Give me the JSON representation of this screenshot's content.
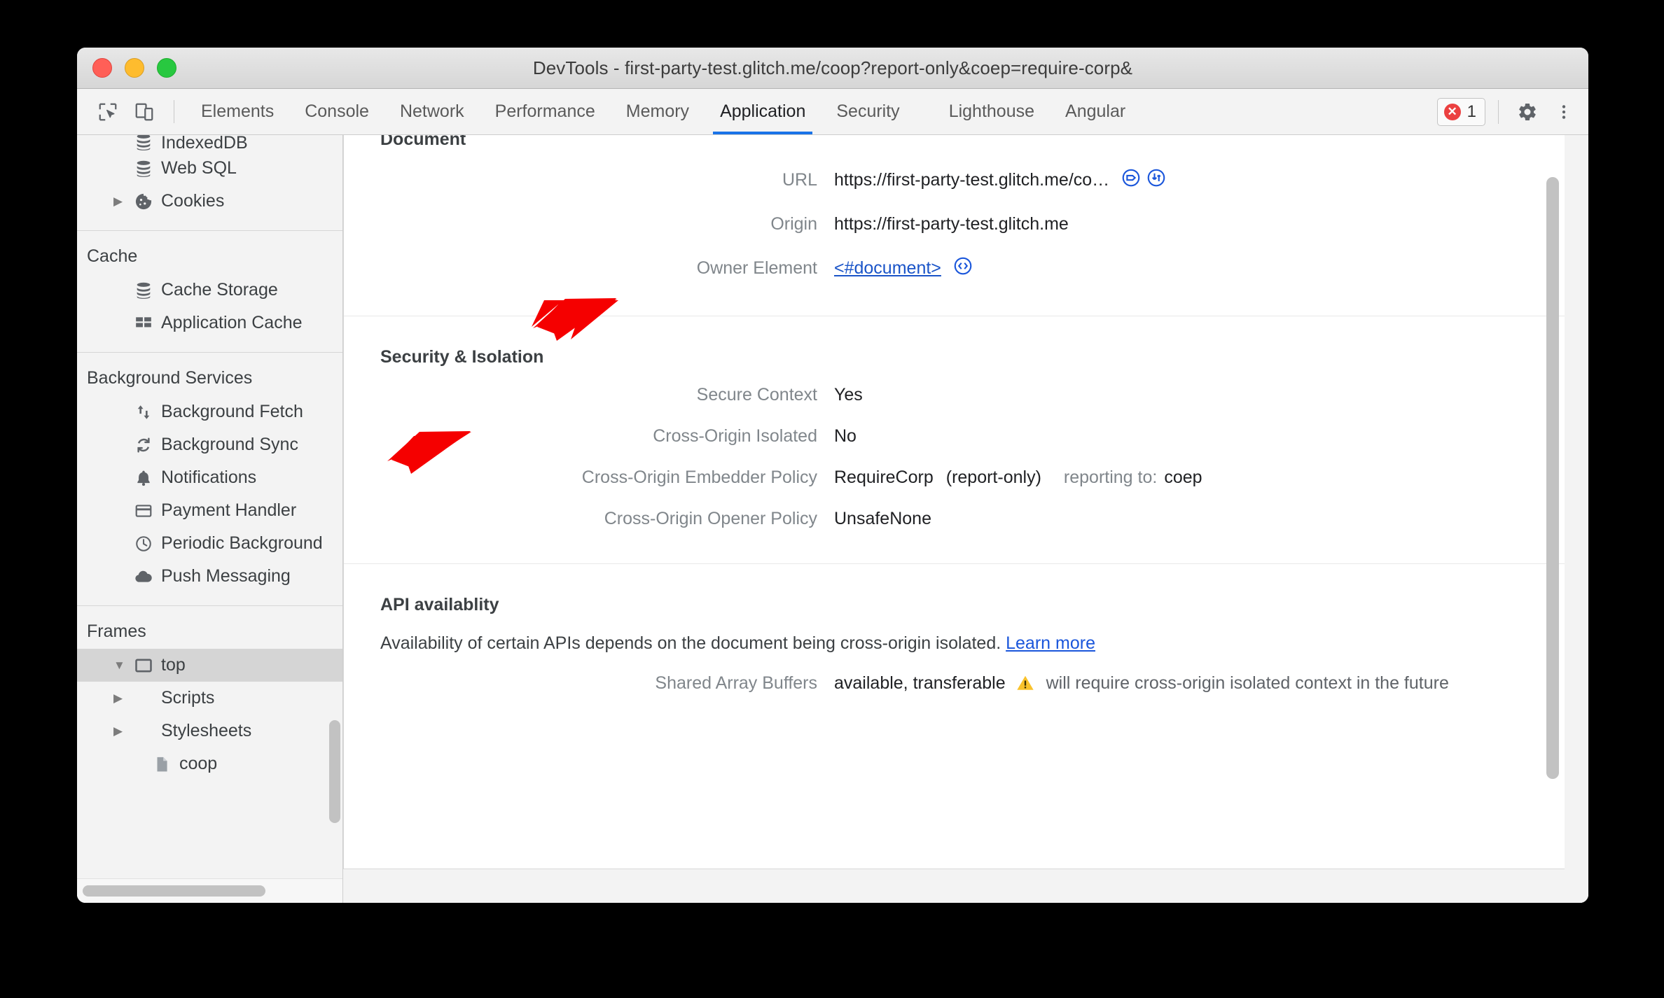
{
  "window": {
    "title": "DevTools - first-party-test.glitch.me/coop?report-only&coep=require-corp&"
  },
  "toolbar": {
    "inspect_icon": "inspect-element-icon",
    "device_icon": "device-toolbar-icon",
    "tabs": [
      {
        "label": "Elements",
        "selected": false
      },
      {
        "label": "Console",
        "selected": false
      },
      {
        "label": "Network",
        "selected": false
      },
      {
        "label": "Performance",
        "selected": false
      },
      {
        "label": "Memory",
        "selected": false
      },
      {
        "label": "Application",
        "selected": true
      },
      {
        "label": "Security",
        "selected": false
      },
      {
        "label": "Lighthouse",
        "selected": false
      },
      {
        "label": "Angular",
        "selected": false
      }
    ],
    "error_count": "1",
    "settings_icon": "gear-icon",
    "more_icon": "kebab-menu-icon"
  },
  "sidebar": {
    "groups": [
      {
        "header": null,
        "items": [
          {
            "label": "IndexedDB",
            "icon": "database-icon",
            "twisty": "",
            "indent": 1,
            "clipped": true,
            "selected": false
          },
          {
            "label": "Web SQL",
            "icon": "database-icon",
            "twisty": "",
            "indent": 1,
            "clipped": false,
            "selected": false
          },
          {
            "label": "Cookies",
            "icon": "cookie-icon",
            "twisty": "▶",
            "indent": 1,
            "clipped": false,
            "selected": false
          }
        ]
      },
      {
        "header": "Cache",
        "items": [
          {
            "label": "Cache Storage",
            "icon": "database-icon",
            "twisty": "",
            "indent": 2,
            "clipped": false,
            "selected": false
          },
          {
            "label": "Application Cache",
            "icon": "grid-icon",
            "twisty": "",
            "indent": 2,
            "clipped": false,
            "selected": false
          }
        ]
      },
      {
        "header": "Background Services",
        "items": [
          {
            "label": "Background Fetch",
            "icon": "updown-arrows-icon",
            "twisty": "",
            "indent": 2,
            "clipped": false,
            "selected": false
          },
          {
            "label": "Background Sync",
            "icon": "sync-icon",
            "twisty": "",
            "indent": 2,
            "clipped": false,
            "selected": false
          },
          {
            "label": "Notifications",
            "icon": "bell-icon",
            "twisty": "",
            "indent": 2,
            "clipped": false,
            "selected": false
          },
          {
            "label": "Payment Handler",
            "icon": "credit-card-icon",
            "twisty": "",
            "indent": 2,
            "clipped": false,
            "selected": false
          },
          {
            "label": "Periodic Background",
            "icon": "clock-icon",
            "twisty": "",
            "indent": 2,
            "clipped": false,
            "selected": false
          },
          {
            "label": "Push Messaging",
            "icon": "cloud-icon",
            "twisty": "",
            "indent": 2,
            "clipped": false,
            "selected": false
          }
        ]
      },
      {
        "header": "Frames",
        "items": [
          {
            "label": "top",
            "icon": "frame-icon",
            "twisty": "▼",
            "indent": 1,
            "clipped": false,
            "selected": true
          },
          {
            "label": "Scripts",
            "icon": "",
            "twisty": "▶",
            "indent": 2,
            "clipped": false,
            "selected": false
          },
          {
            "label": "Stylesheets",
            "icon": "",
            "twisty": "▶",
            "indent": 2,
            "clipped": false,
            "selected": false
          },
          {
            "label": "coop",
            "icon": "document-icon",
            "twisty": "",
            "indent": 3,
            "clipped": false,
            "selected": false
          }
        ]
      }
    ]
  },
  "content": {
    "document_section": {
      "title": "Document",
      "rows": [
        {
          "label": "URL",
          "value": "https://first-party-test.glitch.me/co…",
          "icons": [
            "reveal-in-network-icon",
            "open-in-sources-icon"
          ]
        },
        {
          "label": "Origin",
          "value": "https://first-party-test.glitch.me",
          "icons": []
        },
        {
          "label": "Owner Element",
          "value": "<#document>",
          "icons": [
            "reveal-in-elements-icon"
          ],
          "is_link": true
        }
      ]
    },
    "security_section": {
      "title": "Security & Isolation",
      "rows": [
        {
          "label": "Secure Context",
          "value": "Yes",
          "sub": "",
          "note_label": "",
          "note_value": ""
        },
        {
          "label": "Cross-Origin Isolated",
          "value": "No",
          "sub": "",
          "note_label": "",
          "note_value": ""
        },
        {
          "label": "Cross-Origin Embedder Policy",
          "value": "RequireCorp",
          "sub": "(report-only)",
          "note_label": "reporting to:",
          "note_value": "coep"
        },
        {
          "label": "Cross-Origin Opener Policy",
          "value": "UnsafeNone",
          "sub": "",
          "note_label": "",
          "note_value": ""
        }
      ]
    },
    "api_section": {
      "title": "API availablity",
      "description": "Availability of certain APIs depends on the document being cross-origin isolated.",
      "learn_more": "Learn more",
      "rows": [
        {
          "label": "Shared Array Buffers",
          "value": "available, transferable",
          "warn_icon": "warning-triangle-icon",
          "note": "will require cross-origin isolated context in the future"
        }
      ]
    }
  },
  "annotations": {
    "arrow_color": "#f50000",
    "arrows": [
      {
        "name": "arrow-cross-origin-isolated",
        "target": "Cross-Origin Isolated value"
      },
      {
        "name": "arrow-api-availability",
        "target": "API availablity heading"
      }
    ]
  },
  "colors": {
    "accent": "#1a73e8",
    "link": "#1a56db",
    "error": "#eb4040",
    "warning": "#f9c22b",
    "arrow": "#f50000",
    "sidebar_bg": "#f3f3f3",
    "selected_row": "#d5d5d5"
  }
}
